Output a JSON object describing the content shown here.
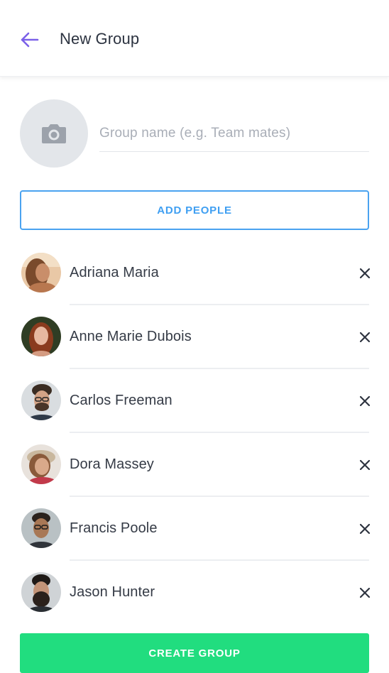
{
  "header": {
    "title": "New Group",
    "back_icon": "arrow-left-icon",
    "accent": "#7b61e8"
  },
  "group": {
    "photo_icon": "camera-icon",
    "name_value": "",
    "name_placeholder": "Group name (e.g. Team mates)"
  },
  "add_people": {
    "label": "ADD PEOPLE",
    "color": "#3f9ff2"
  },
  "people": [
    {
      "name": "Adriana Maria",
      "remove_icon": "close-icon"
    },
    {
      "name": "Anne Marie Dubois",
      "remove_icon": "close-icon"
    },
    {
      "name": "Carlos Freeman",
      "remove_icon": "close-icon"
    },
    {
      "name": "Dora Massey",
      "remove_icon": "close-icon"
    },
    {
      "name": "Francis Poole",
      "remove_icon": "close-icon"
    },
    {
      "name": "Jason Hunter",
      "remove_icon": "close-icon"
    }
  ],
  "create_button": {
    "label": "CREATE GROUP",
    "color": "#21dd7f"
  }
}
